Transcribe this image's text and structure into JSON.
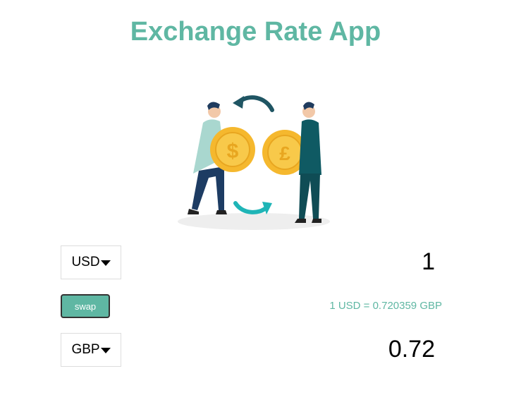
{
  "app": {
    "title": "Exchange Rate App"
  },
  "from": {
    "currency": "USD",
    "amount": "1"
  },
  "to": {
    "currency": "GBP",
    "amount": "0.72"
  },
  "swap": {
    "label": "swap"
  },
  "rate": {
    "text": "1 USD = 0.720359 GBP"
  },
  "illustration": {
    "icon": "currency-exchange-illustration",
    "left_coin_symbol": "$",
    "right_coin_symbol": "£"
  },
  "colors": {
    "accent": "#5fb7a3",
    "coin": "#f5b82e",
    "arrow_dark": "#1f5563",
    "arrow_light": "#1fb5b7"
  }
}
